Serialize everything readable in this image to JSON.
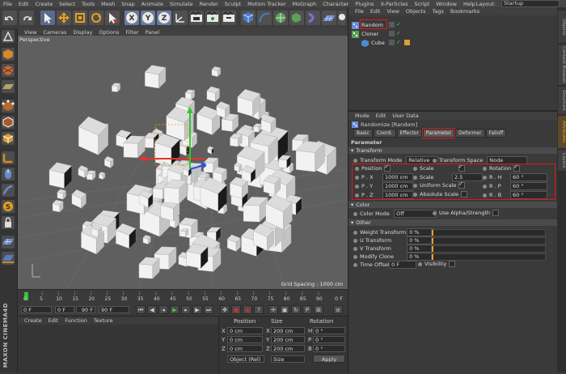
{
  "menubar": {
    "items": [
      "File",
      "Edit",
      "Create",
      "Select",
      "Tools",
      "Mesh",
      "Snap",
      "Animate",
      "Simulate",
      "Render",
      "Sculpt",
      "Motion Tracker",
      "MoGraph",
      "Character",
      "Plugins",
      "X-Particles",
      "Script",
      "Window",
      "Help"
    ],
    "layout_label": "Layout:",
    "layout_value": "Startup"
  },
  "viewport": {
    "menu": [
      "View",
      "Cameras",
      "Display",
      "Options",
      "Filter",
      "Panel"
    ],
    "label": "Perspective",
    "grid_spacing": "Grid Spacing : 1000 cm"
  },
  "timeline": {
    "ticks": [
      "0",
      "5",
      "10",
      "15",
      "20",
      "25",
      "30",
      "35",
      "40",
      "45",
      "50",
      "55",
      "60",
      "65",
      "70",
      "75",
      "80",
      "85",
      "90"
    ],
    "end_frame_label": "0 F"
  },
  "transport": {
    "start": "0 F",
    "current": "0 F",
    "end_preview": "90 F",
    "end": "90 F"
  },
  "material_manager": {
    "menu": [
      "Create",
      "Edit",
      "Function",
      "Texture"
    ]
  },
  "coordinates": {
    "headers": [
      "Position",
      "Size",
      "Rotation"
    ],
    "rows": [
      {
        "axis": "X",
        "pos": "0 cm",
        "size_axis": "X",
        "size": "200 cm",
        "rot_axis": "H",
        "rot": "0 °"
      },
      {
        "axis": "Y",
        "pos": "0 cm",
        "size_axis": "Y",
        "size": "200 cm",
        "rot_axis": "P",
        "rot": "0 °"
      },
      {
        "axis": "Z",
        "pos": "0 cm",
        "size_axis": "Z",
        "size": "200 cm",
        "rot_axis": "B",
        "rot": "0 °"
      }
    ],
    "mode": "Object (Rel)",
    "size_mode": "Size",
    "apply": "Apply"
  },
  "object_manager": {
    "menu": [
      "File",
      "Edit",
      "View",
      "Objects",
      "Tags",
      "Bookmarks"
    ],
    "objects": [
      {
        "name": "Random",
        "level": 0
      },
      {
        "name": "Cloner",
        "level": 0
      },
      {
        "name": "Cube",
        "level": 1
      }
    ]
  },
  "side_tabs": [
    "Objects",
    "Content Browser",
    "Structure",
    "Attributes",
    "Layers"
  ],
  "attributes": {
    "menu": [
      "Mode",
      "Edit",
      "User Data"
    ],
    "title": "Randomize [Random]",
    "tabs": [
      "Basic",
      "Coord.",
      "Effector",
      "Parameter",
      "Deformer",
      "Falloff"
    ],
    "active_tab": "Parameter",
    "parameter_label": "Parameter",
    "transform_section": "Transform",
    "transform_mode_label": "Transform Mode",
    "transform_mode": "Relative",
    "transform_space_label": "Transform Space",
    "transform_space": "Node",
    "position_label": "Position",
    "scale_label": "Scale",
    "rotation_label": "Rotation",
    "px_label": "P . X",
    "px": "1000 cm",
    "py_label": "P . Y",
    "py": "1000 cm",
    "pz_label": "P . Z",
    "pz": "1000 cm",
    "scale_val_label": "Scale",
    "scale_val": "2.5",
    "uniform_scale_label": "Uniform Scale",
    "absolute_scale_label": "Absolute Scale",
    "rh_label": "R . H",
    "rh": "60 °",
    "rp_label": "R . P",
    "rp": "60 °",
    "rb_label": "R . B",
    "rb": "60 °",
    "color_section": "Color",
    "color_mode_label": "Color Mode",
    "color_mode": "Off",
    "use_alpha_label": "Use Alpha/Strength",
    "other_section": "Other",
    "weight_label": "Weight Transform",
    "weight": "0 %",
    "u_label": "U Transform",
    "u": "0 %",
    "v_label": "V Transform",
    "v": "0 %",
    "modify_label": "Modify Clone",
    "modify": "0 %",
    "time_offset_label": "Time Offset",
    "time_offset": "0 F",
    "visibility_label": "Visibility"
  }
}
